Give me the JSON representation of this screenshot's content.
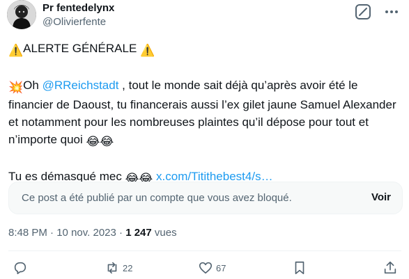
{
  "author": {
    "name": "Pr fentedelynx",
    "handle": "@Olivierfente"
  },
  "tweet": {
    "warn_emoji": "⚠️",
    "alert_title": "ALERTE GÉNÉRALE",
    "collision_emoji": "💥",
    "line1_pre": "Oh ",
    "mention": "@RReichstadt",
    "line1_post": " , tout le monde sait déjà qu’après avoir été le financier de Daoust, tu financerais aussi l’ex gilet jaune Samuel Alexander et notamment pour les nombreuses plaintes qu’il dépose pour tout et n’importe quoi ",
    "laugh_emoji": "😂😂",
    "line2_pre": "Tu es démasqué mec ",
    "link": "x.com/Titithebest4/s…"
  },
  "blocked_card": {
    "text": "Ce post a été publié par un compte que vous avez bloqué.",
    "button": "Voir"
  },
  "meta": {
    "time": "8:48 PM",
    "sep1": " · ",
    "date": "10 nov. 2023",
    "sep2": " · ",
    "views": "1 247",
    "views_label": " vues"
  },
  "actions": {
    "reply": "",
    "repost": "22",
    "like": "67",
    "bookmark": "",
    "share": ""
  }
}
